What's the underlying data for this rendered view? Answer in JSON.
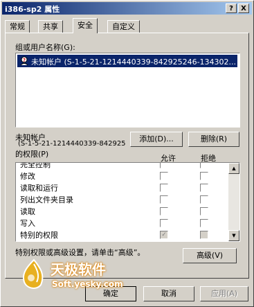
{
  "window": {
    "title": "i386-sp2 属性"
  },
  "title_buttons": {
    "help": "?",
    "close": "X"
  },
  "tabs": [
    {
      "label": "常规"
    },
    {
      "label": "共享"
    },
    {
      "label": "安全"
    },
    {
      "label": "自定义"
    }
  ],
  "security": {
    "group_label": "组或用户名称(G):",
    "users": [
      {
        "name": "未知帐户 (S-1-5-21-1214440339-842925246-134302..."
      }
    ],
    "add_button": "添加(D)...",
    "remove_button": "删除(R)",
    "selected_account_line1": "未知帐户",
    "selected_account_line2": "(S-1-5-21-1214440339-842925",
    "permissions_label": "的权限(P)",
    "allow_header": "允许",
    "deny_header": "拒绝",
    "permissions": [
      {
        "name": "完全控制",
        "allow": false,
        "deny": false
      },
      {
        "name": "修改",
        "allow": false,
        "deny": false
      },
      {
        "name": "读取和运行",
        "allow": false,
        "deny": false
      },
      {
        "name": "列出文件夹目录",
        "allow": false,
        "deny": false
      },
      {
        "name": "读取",
        "allow": false,
        "deny": false
      },
      {
        "name": "写入",
        "allow": false,
        "deny": false
      },
      {
        "name": "特别的权限",
        "allow": true,
        "deny": false
      }
    ],
    "advanced_hint": "特别权限或高级设置，请单击“高级”。",
    "advanced_button": "高级(V)"
  },
  "footer": {
    "ok": "确定",
    "cancel": "取消",
    "apply": "应用(A)"
  },
  "watermark": {
    "brand": "天极软件",
    "url": "Soft.yesky.com"
  }
}
